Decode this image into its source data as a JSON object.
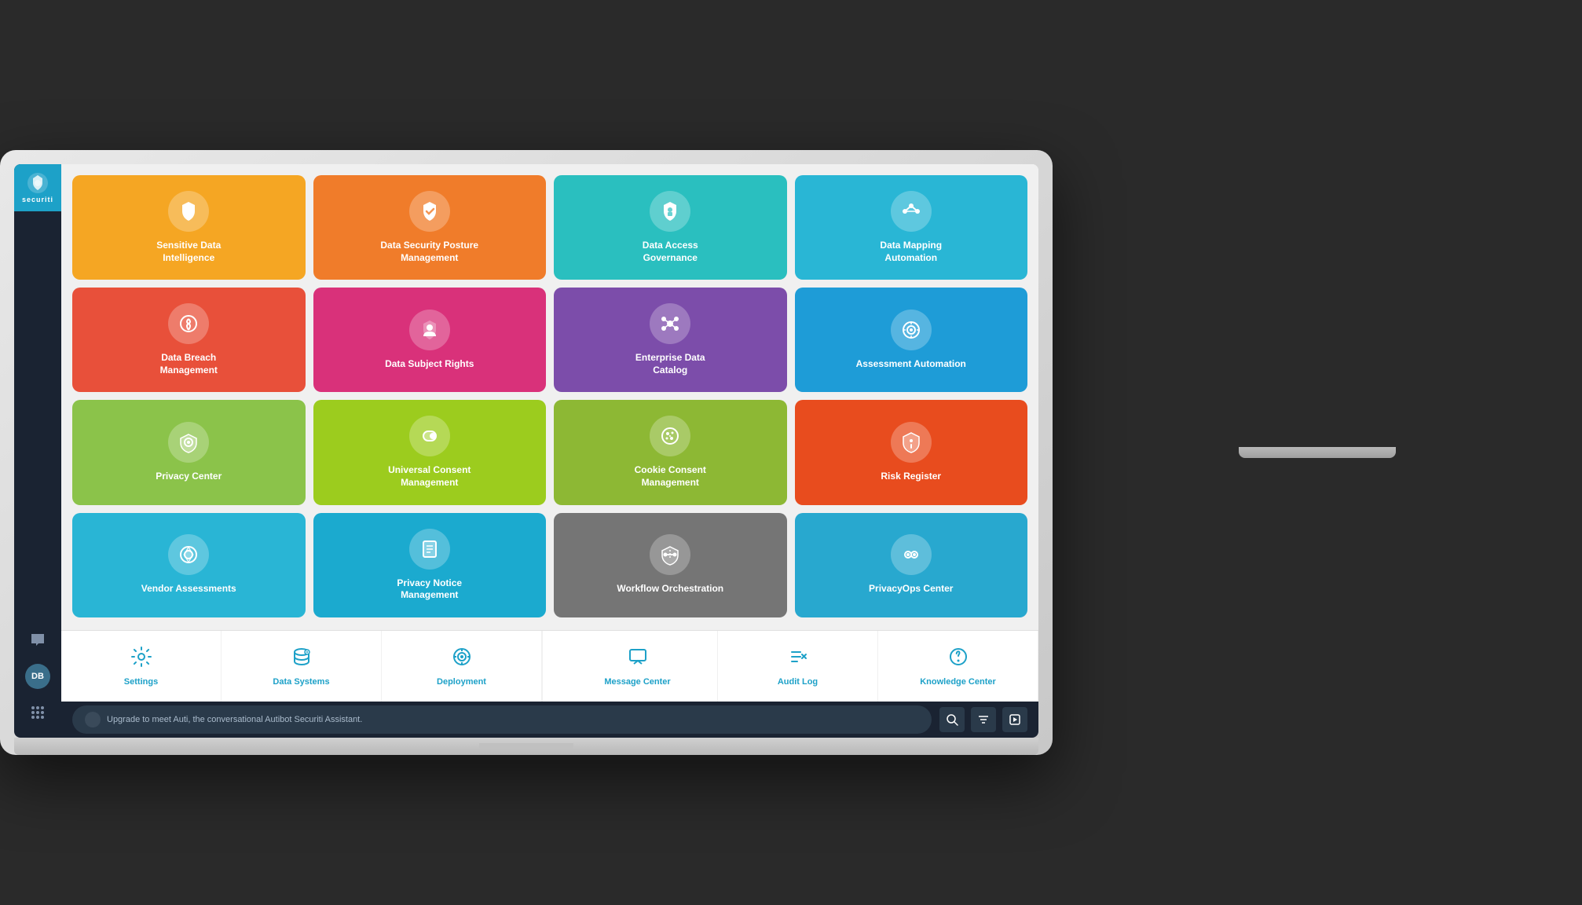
{
  "sidebar": {
    "logo_text": "securiti",
    "bottom_icons": [
      "💬",
      "🔵",
      "⠿"
    ]
  },
  "tiles": {
    "row1": [
      {
        "id": "sensitive-data-intelligence",
        "label": "Sensitive Data\nIntelligence",
        "color": "tile-orange",
        "icon": "🛡"
      },
      {
        "id": "data-security-posture",
        "label": "Data Security Posture\nManagement",
        "color": "tile-orange2",
        "icon": "✔"
      },
      {
        "id": "data-access-governance",
        "label": "Data Access\nGovernance",
        "color": "tile-teal",
        "icon": "🔐"
      },
      {
        "id": "data-mapping-automation",
        "label": "Data Mapping\nAutomation",
        "color": "tile-lightblue",
        "icon": "⟷"
      }
    ],
    "row2": [
      {
        "id": "data-breach-management",
        "label": "Data Breach\nManagement",
        "color": "tile-red",
        "icon": "📡"
      },
      {
        "id": "data-subject-rights",
        "label": "Data Subject Rights",
        "color": "tile-pink",
        "icon": "⚙"
      },
      {
        "id": "enterprise-data-catalog",
        "label": "Enterprise Data\nCatalog",
        "color": "tile-purple",
        "icon": "✦"
      },
      {
        "id": "assessment-automation",
        "label": "Assessment Automation",
        "color": "tile-blue",
        "icon": "◎"
      }
    ],
    "row3": [
      {
        "id": "privacy-center",
        "label": "Privacy Center",
        "color": "tile-green",
        "icon": "⬡"
      },
      {
        "id": "universal-consent",
        "label": "Universal Consent\nManagement",
        "color": "tile-green2",
        "icon": "⇌"
      },
      {
        "id": "cookie-consent",
        "label": "Cookie Consent\nManagement",
        "color": "tile-green3",
        "icon": "🍪"
      },
      {
        "id": "risk-register",
        "label": "Risk Register",
        "color": "tile-orange3",
        "icon": "⚠"
      }
    ],
    "row4": [
      {
        "id": "vendor-assessments",
        "label": "Vendor Assessments",
        "color": "tile-cyan",
        "icon": "◈"
      },
      {
        "id": "privacy-notice",
        "label": "Privacy Notice\nManagement",
        "color": "tile-cyan2",
        "icon": "📋"
      },
      {
        "id": "workflow-orchestration",
        "label": "Workflow Orchestration",
        "color": "tile-gray",
        "icon": "⬡"
      },
      {
        "id": "privacyops-center",
        "label": "PrivacyOps Center",
        "color": "tile-cyan3",
        "icon": "👁"
      }
    ]
  },
  "tools": [
    {
      "id": "settings",
      "label": "Settings",
      "icon": "⚙"
    },
    {
      "id": "data-systems",
      "label": "Data Systems",
      "icon": "🗄"
    },
    {
      "id": "deployment",
      "label": "Deployment",
      "icon": "⚙"
    },
    {
      "id": "message-center",
      "label": "Message Center",
      "icon": "💬"
    },
    {
      "id": "audit-log",
      "label": "Audit Log",
      "icon": "≡✗"
    },
    {
      "id": "knowledge-center",
      "label": "Knowledge Center",
      "icon": "?"
    }
  ],
  "status_bar": {
    "chat_text": "Upgrade to meet Auti, the conversational Autibot Securiti Assistant."
  }
}
